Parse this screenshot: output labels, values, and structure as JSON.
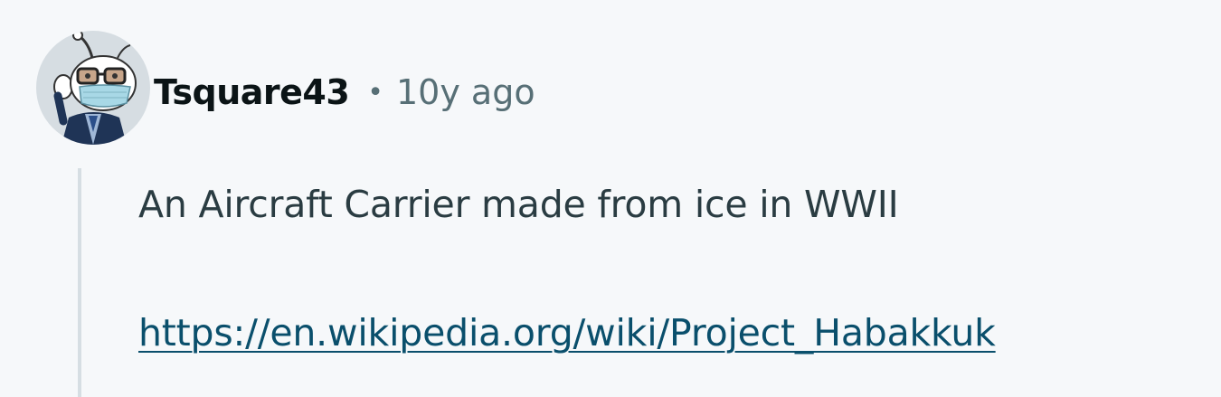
{
  "comment": {
    "author": "Tsquare43",
    "separator": "•",
    "timestamp": "10y ago",
    "body": "An Aircraft Carrier made from ice in WWII",
    "link": "https://en.wikipedia.org/wiki/Project_Habakkuk"
  },
  "avatar": {
    "icon": "snoo-avatar-icon"
  },
  "colors": {
    "background": "#f6f8fa",
    "author": "#0b1416",
    "meta": "#576f76",
    "body": "#2a3c42",
    "link": "#0a4f6c",
    "thread_line": "#d6dee3"
  }
}
